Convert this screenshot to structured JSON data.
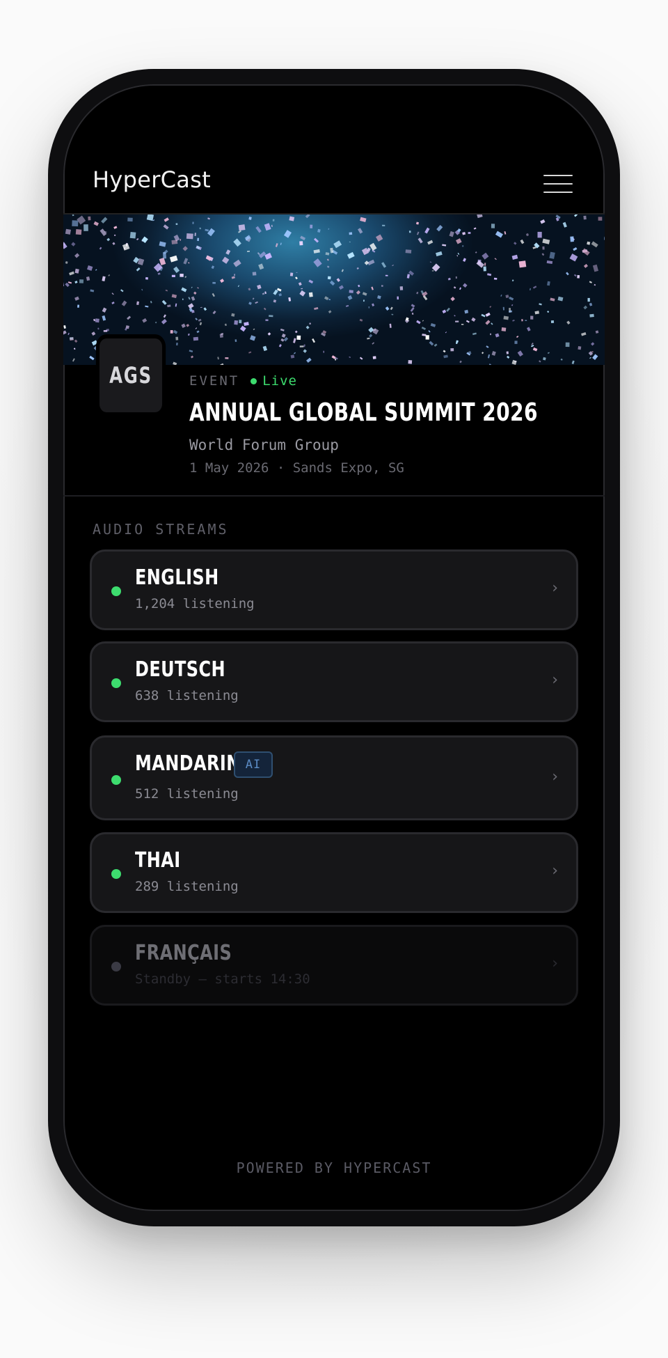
{
  "app": {
    "logo": "HyperCast"
  },
  "event": {
    "avatar_initials": "AGS",
    "label": "EVENT",
    "status": "Live",
    "title": "ANNUAL GLOBAL SUMMIT 2026",
    "organizer": "World Forum Group",
    "meta": "1 May 2026 · Sands Expo, SG"
  },
  "streams": {
    "heading": "AUDIO STREAMS",
    "items": [
      {
        "name": "ENGLISH",
        "sub": "1,204 listening",
        "status": "live"
      },
      {
        "name": "DEUTSCH",
        "sub": "638 listening",
        "status": "live"
      },
      {
        "name": "MANDARIN",
        "badge": "AI",
        "sub": "512 listening",
        "status": "live"
      },
      {
        "name": "THAI",
        "sub": "289 listening",
        "status": "live"
      },
      {
        "name": "FRANÇAIS",
        "sub": "Standby — starts 14:30",
        "status": "standby"
      }
    ],
    "chevron": "›"
  },
  "footer": {
    "text": "POWERED BY HYPERCAST"
  },
  "colors": {
    "live": "#3ddc6e",
    "standby": "#3a3a44",
    "badge": "#5b8bc4"
  }
}
